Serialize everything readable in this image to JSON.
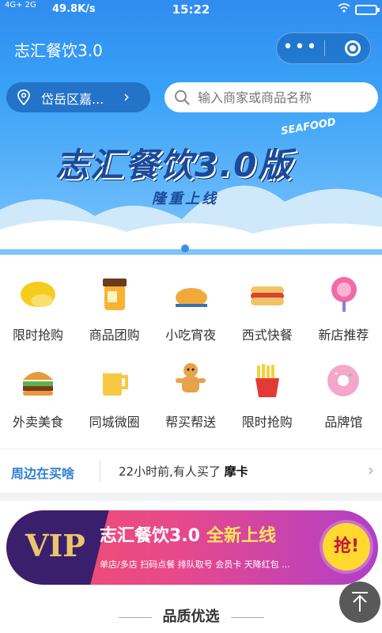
{
  "status_bar": {
    "network": "4G+ 2G",
    "speed": "49.8K/s",
    "time": "15:22"
  },
  "header": {
    "title": "志汇餐饮3.0",
    "more_icon": "more-dots-icon",
    "close_icon": "target-circle-icon"
  },
  "location": {
    "label": "岱岳区嘉...",
    "icon": "location-pin-icon"
  },
  "search": {
    "placeholder": "输入商家或商品名称",
    "icon": "search-icon"
  },
  "banner": {
    "title": "志汇餐饮3.0版",
    "subtitle": "隆重上线",
    "decor_text": "SEAFOOD"
  },
  "categories": [
    {
      "label": "限时抢购",
      "icon": "lemon-icon"
    },
    {
      "label": "商品团购",
      "icon": "honey-jar-icon"
    },
    {
      "label": "小吃宵夜",
      "icon": "roast-chicken-icon"
    },
    {
      "label": "西式快餐",
      "icon": "hotdog-icon"
    },
    {
      "label": "新店推荐",
      "icon": "lollipop-icon"
    },
    {
      "label": "外卖美食",
      "icon": "burger-icon"
    },
    {
      "label": "同城微圈",
      "icon": "beer-mug-icon"
    },
    {
      "label": "帮买帮送",
      "icon": "gingerbread-icon"
    },
    {
      "label": "限时抢购",
      "icon": "fries-icon"
    },
    {
      "label": "品牌馆",
      "icon": "donut-icon"
    }
  ],
  "ticker": {
    "tag": "周边在买啥",
    "message_prefix": "22小时前,有人买了",
    "message_item": "摩卡"
  },
  "vip_banner": {
    "badge": "VIP",
    "title": "志汇餐饮3.0",
    "highlight": "全新上线",
    "features": "单店/多店  扫码点餐  排队取号  会员卡  天降红包 ...",
    "action": "抢!"
  },
  "section_title": "品质优选",
  "colors": {
    "primary": "#2f8cf0",
    "ticker_tag": "#2f7fd0",
    "vip_gold": "#e9c66c"
  }
}
